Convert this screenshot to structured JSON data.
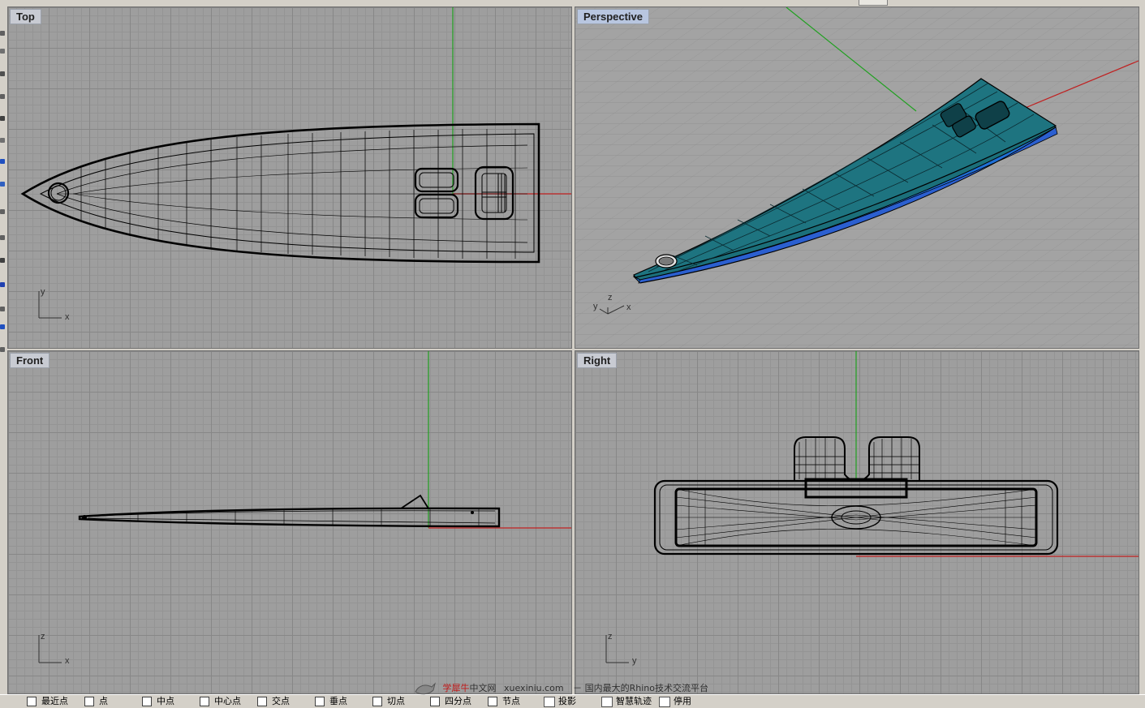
{
  "viewports": {
    "top": {
      "title": "Top",
      "axis_h": "x",
      "axis_v": "y"
    },
    "perspective": {
      "title": "Perspective",
      "axis_x": "x",
      "axis_y": "y",
      "axis_z": "z"
    },
    "front": {
      "title": "Front",
      "axis_h": "x",
      "axis_v": "z"
    },
    "right": {
      "title": "Right",
      "axis_h": "y",
      "axis_v": "z"
    }
  },
  "colors": {
    "viewport_bg": "#9e9e9e",
    "grid_major": "#878787",
    "grid_minor": "#949494",
    "x_axis": "#c02020",
    "y_axis": "#20a020",
    "surface_shade": "#1b6f7a",
    "surface_edge": "#0d2f8c",
    "wire": "#000000"
  },
  "status_bar": {
    "osnaps": [
      "最近点",
      "点",
      "中点",
      "中心点",
      "交点",
      "垂点",
      "切点",
      "四分点",
      "节点"
    ],
    "toggles": [
      "投影",
      "智慧轨迹",
      "停用"
    ]
  },
  "watermark": {
    "brand": "学犀牛",
    "brand_suffix": "中文网",
    "domain": "xuexiniu.com",
    "tagline": "－ 国内最大的Rhino技术交流平台"
  }
}
